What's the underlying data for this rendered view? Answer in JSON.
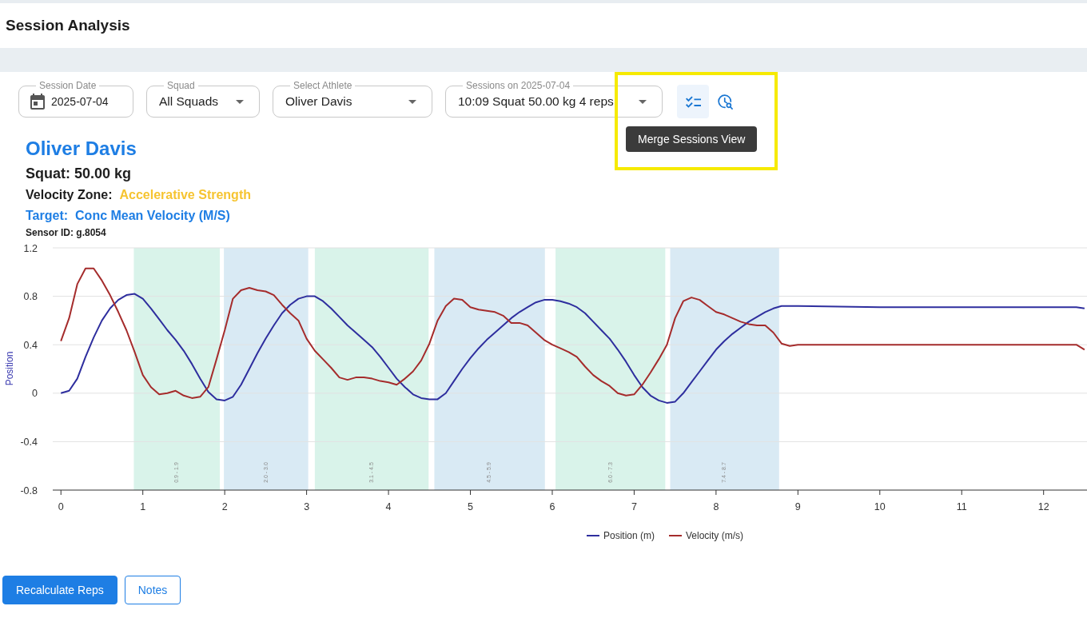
{
  "top_bar": {
    "title": "Session Analysis"
  },
  "filters": [
    {
      "kind": "date",
      "label": "Session Date",
      "value": "2025-07-04"
    },
    {
      "kind": "select",
      "label": "Squad",
      "value": "All Squads"
    },
    {
      "kind": "select",
      "label": "Select Athlete",
      "value": "Oliver Davis"
    },
    {
      "kind": "select",
      "label": "Sessions on 2025-07-04",
      "value": "10:09 Squat 50.00 kg 4 reps"
    }
  ],
  "view_buttons": [
    {
      "kind": "merge",
      "hovered": true,
      "highlighted": true,
      "tooltip": "Merge Sessions View"
    },
    {
      "kind": "history",
      "hovered": false,
      "highlighted": false
    }
  ],
  "athlete": {
    "name": "Oliver Davis",
    "exercise": "Squat: 50.00 kg",
    "zone_label": "Velocity Zone:",
    "zone": "Accelerative Strength",
    "target_label": "Target:",
    "target": "Conc Mean Velocity (M/S)",
    "sensor": "Sensor ID: g.8054"
  },
  "chart": {
    "chart_data": {
      "type": "line",
      "ylabel": "Position",
      "xlim": [
        -0.1,
        12.53
      ],
      "ylim": [
        -0.8,
        1.2
      ],
      "xticks": [
        0,
        1,
        2,
        3,
        4,
        5,
        6,
        7,
        8,
        9,
        10,
        11,
        12
      ],
      "yticks": [
        -0.8,
        -0.4,
        0,
        0.4,
        0.8,
        1.2
      ],
      "grid": "y",
      "legend": "bottom",
      "x": [
        0,
        0.1,
        0.2,
        0.3,
        0.4,
        0.5,
        0.6,
        0.7,
        0.8,
        0.9,
        1,
        1.1,
        1.2,
        1.3,
        1.4,
        1.5,
        1.6,
        1.7,
        1.8,
        1.9,
        2,
        2.1,
        2.2,
        2.3,
        2.4,
        2.5,
        2.6,
        2.7,
        2.8,
        2.9,
        3,
        3.1,
        3.2,
        3.3,
        3.4,
        3.5,
        3.6,
        3.7,
        3.8,
        3.9,
        4,
        4.1,
        4.2,
        4.3,
        4.4,
        4.5,
        4.6,
        4.7,
        4.8,
        4.9,
        5,
        5.1,
        5.2,
        5.3,
        5.4,
        5.5,
        5.6,
        5.7,
        5.8,
        5.9,
        6,
        6.1,
        6.2,
        6.3,
        6.4,
        6.5,
        6.6,
        6.7,
        6.8,
        6.9,
        7,
        7.1,
        7.2,
        7.3,
        7.4,
        7.5,
        7.6,
        7.7,
        7.8,
        7.9,
        8,
        8.1,
        8.2,
        8.3,
        8.4,
        8.5,
        8.6,
        8.7,
        8.8,
        8.9,
        9,
        10,
        11,
        12,
        12.4,
        12.5
      ],
      "series": [
        {
          "name": "Position (m)",
          "color": "#2e2e9e",
          "values": [
            0,
            0.02,
            0.12,
            0.3,
            0.46,
            0.6,
            0.7,
            0.77,
            0.81,
            0.82,
            0.78,
            0.7,
            0.61,
            0.52,
            0.44,
            0.35,
            0.24,
            0.12,
            0.01,
            -0.05,
            -0.06,
            -0.03,
            0.07,
            0.2,
            0.33,
            0.45,
            0.56,
            0.66,
            0.73,
            0.78,
            0.8,
            0.8,
            0.76,
            0.7,
            0.63,
            0.56,
            0.5,
            0.44,
            0.38,
            0.3,
            0.21,
            0.12,
            0.05,
            -0.01,
            -0.04,
            -0.05,
            -0.05,
            0,
            0.1,
            0.2,
            0.29,
            0.37,
            0.44,
            0.5,
            0.56,
            0.62,
            0.67,
            0.71,
            0.75,
            0.77,
            0.77,
            0.76,
            0.74,
            0.71,
            0.66,
            0.59,
            0.52,
            0.45,
            0.36,
            0.26,
            0.15,
            0.05,
            -0.02,
            -0.06,
            -0.08,
            -0.07,
            0,
            0.09,
            0.18,
            0.27,
            0.36,
            0.43,
            0.49,
            0.54,
            0.59,
            0.63,
            0.67,
            0.7,
            0.72,
            0.72,
            0.72,
            0.71,
            0.71,
            0.71,
            0.71,
            0.7
          ]
        },
        {
          "name": "Velocity (m/s)",
          "color": "#a52c2c",
          "values": [
            0.43,
            0.62,
            0.9,
            1.03,
            1.03,
            0.93,
            0.81,
            0.67,
            0.52,
            0.34,
            0.15,
            0.05,
            -0.01,
            0,
            0.02,
            -0.02,
            -0.04,
            -0.03,
            0.05,
            0.28,
            0.52,
            0.78,
            0.85,
            0.87,
            0.85,
            0.84,
            0.81,
            0.73,
            0.66,
            0.6,
            0.45,
            0.35,
            0.28,
            0.21,
            0.13,
            0.11,
            0.13,
            0.13,
            0.12,
            0.1,
            0.09,
            0.07,
            0.12,
            0.18,
            0.27,
            0.41,
            0.6,
            0.72,
            0.78,
            0.77,
            0.71,
            0.69,
            0.68,
            0.67,
            0.64,
            0.58,
            0.58,
            0.56,
            0.5,
            0.44,
            0.4,
            0.37,
            0.34,
            0.3,
            0.22,
            0.15,
            0.1,
            0.06,
            0,
            -0.02,
            -0.01,
            0.07,
            0.17,
            0.28,
            0.4,
            0.62,
            0.76,
            0.79,
            0.77,
            0.72,
            0.67,
            0.65,
            0.62,
            0.59,
            0.57,
            0.56,
            0.56,
            0.5,
            0.41,
            0.39,
            0.4,
            0.4,
            0.4,
            0.4,
            0.4,
            0.36
          ]
        }
      ],
      "bands": [
        {
          "axis": "x",
          "from": 0.89,
          "to": 1.94,
          "label": "0.9 - 1.9",
          "color": "#d9f3ea"
        },
        {
          "axis": "x",
          "from": 1.99,
          "to": 3.02,
          "label": "2.0 - 3.0",
          "color": "#d9eaf4"
        },
        {
          "axis": "x",
          "from": 3.1,
          "to": 4.49,
          "label": "3.1 - 4.5",
          "color": "#d9f3ea"
        },
        {
          "axis": "x",
          "from": 4.56,
          "to": 5.91,
          "label": "4.5 - 5.9",
          "color": "#d9eaf4"
        },
        {
          "axis": "x",
          "from": 6.04,
          "to": 7.38,
          "label": "6.0 - 7.3",
          "color": "#d9f3ea"
        },
        {
          "axis": "x",
          "from": 7.44,
          "to": 8.77,
          "label": "7.4 - 8.7",
          "color": "#d9eaf4"
        }
      ]
    }
  },
  "actions": [
    {
      "kind": "primary",
      "label": "Recalculate Reps"
    },
    {
      "kind": "outline",
      "label": "Notes"
    }
  ]
}
